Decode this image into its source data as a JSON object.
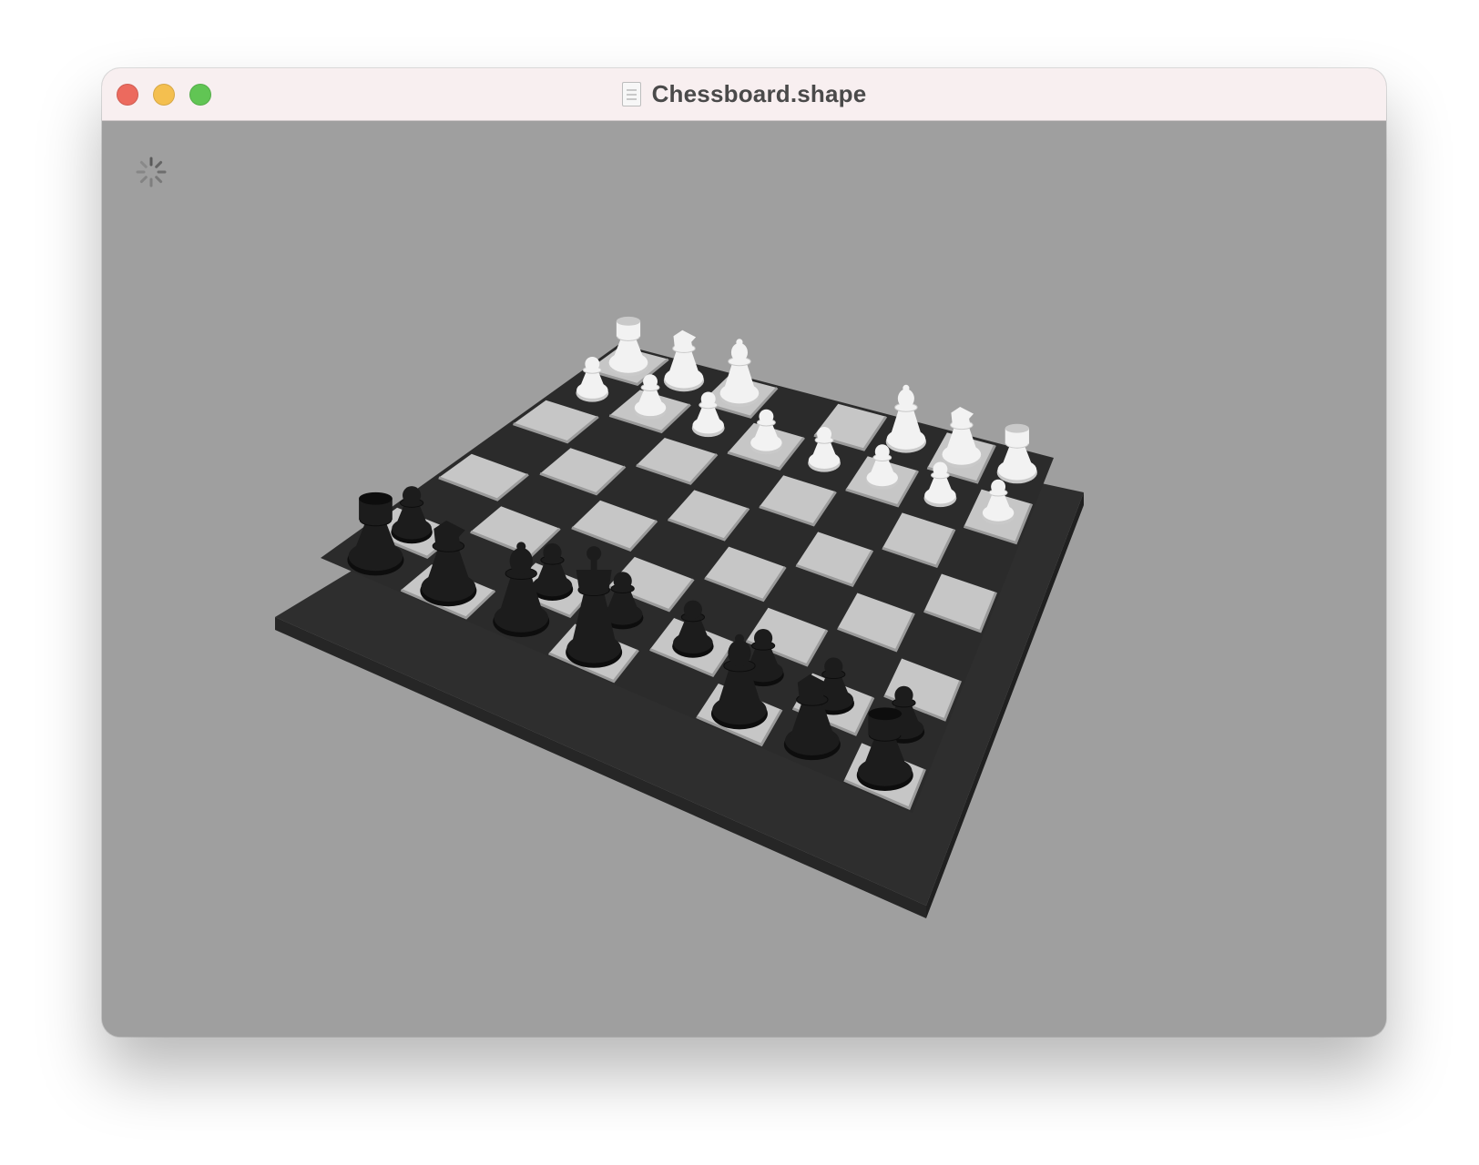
{
  "window": {
    "title": "Chessboard.shape",
    "doc_icon": "document-icon",
    "buttons": {
      "close": "close-icon",
      "minimize": "minimize-icon",
      "zoom": "zoom-icon"
    }
  },
  "viewport": {
    "background": "#9f9f9f",
    "loading_indicator": "spinner-icon"
  },
  "board": {
    "frame_color": "#2e2e2e",
    "light_square": "#c6c6c6",
    "dark_square": "#2b2b2b",
    "white_piece_color": "#f2f2f2",
    "black_piece_color": "#1c1c1c"
  },
  "pieces": [
    {
      "color": "white",
      "type": "rook",
      "square": "a8"
    },
    {
      "color": "white",
      "type": "knight",
      "square": "b8"
    },
    {
      "color": "white",
      "type": "bishop",
      "square": "c8"
    },
    {
      "color": "white",
      "type": "bishop",
      "square": "f8"
    },
    {
      "color": "white",
      "type": "knight",
      "square": "g8"
    },
    {
      "color": "white",
      "type": "rook",
      "square": "h8"
    },
    {
      "color": "white",
      "type": "pawn",
      "square": "a7"
    },
    {
      "color": "white",
      "type": "pawn",
      "square": "b7"
    },
    {
      "color": "white",
      "type": "pawn",
      "square": "c7"
    },
    {
      "color": "white",
      "type": "pawn",
      "square": "d7"
    },
    {
      "color": "white",
      "type": "pawn",
      "square": "e7"
    },
    {
      "color": "white",
      "type": "pawn",
      "square": "f7"
    },
    {
      "color": "white",
      "type": "pawn",
      "square": "g7"
    },
    {
      "color": "white",
      "type": "pawn",
      "square": "h7"
    },
    {
      "color": "black",
      "type": "rook",
      "square": "a1"
    },
    {
      "color": "black",
      "type": "knight",
      "square": "b1"
    },
    {
      "color": "black",
      "type": "bishop",
      "square": "c1"
    },
    {
      "color": "black",
      "type": "king",
      "square": "d1"
    },
    {
      "color": "black",
      "type": "bishop",
      "square": "f1"
    },
    {
      "color": "black",
      "type": "knight",
      "square": "g1"
    },
    {
      "color": "black",
      "type": "rook",
      "square": "h1"
    },
    {
      "color": "black",
      "type": "pawn",
      "square": "a2"
    },
    {
      "color": "black",
      "type": "pawn",
      "square": "c2"
    },
    {
      "color": "black",
      "type": "pawn",
      "square": "d2"
    },
    {
      "color": "black",
      "type": "pawn",
      "square": "e2"
    },
    {
      "color": "black",
      "type": "pawn",
      "square": "f2"
    },
    {
      "color": "black",
      "type": "pawn",
      "square": "g2"
    },
    {
      "color": "black",
      "type": "pawn",
      "square": "h2"
    }
  ]
}
